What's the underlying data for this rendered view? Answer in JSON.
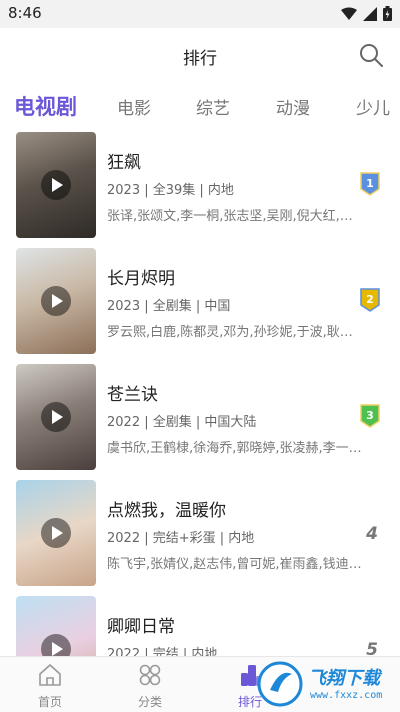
{
  "status_bar": {
    "time": "8:46"
  },
  "header": {
    "title": "排行"
  },
  "tabs": [
    {
      "label": "电视剧",
      "active": true
    },
    {
      "label": "电影",
      "active": false
    },
    {
      "label": "综艺",
      "active": false
    },
    {
      "label": "动漫",
      "active": false
    },
    {
      "label": "少儿",
      "active": false
    }
  ],
  "items": [
    {
      "title": "狂飙",
      "meta": "2023 | 全39集 | 内地",
      "cast": "张译,张颂文,李一桐,张志坚,吴刚,倪大红,韩…",
      "rank": "1"
    },
    {
      "title": "长月烬明",
      "meta": "2023 | 全剧集 | 中国",
      "cast": "罗云熙,白鹿,陈都灵,邓为,孙珍妮,于波,耿業…",
      "rank": "2"
    },
    {
      "title": "苍兰诀",
      "meta": "2022 | 全剧集 | 中国大陆",
      "cast": "虞书欣,王鹤棣,徐海乔,郭晓婷,张凌赫,李一…",
      "rank": "3"
    },
    {
      "title": "点燃我，温暖你",
      "meta": "2022 | 完结+彩蛋 | 内地",
      "cast": "陈飞宇,张婧仪,赵志伟,曾可妮,崔雨鑫,钱迪…",
      "rank": "4"
    },
    {
      "title": "卿卿日常",
      "meta": "2022 | 完结 | 内地",
      "cast": "",
      "rank": "5"
    }
  ],
  "bottom_nav": [
    {
      "label": "首页",
      "active": false
    },
    {
      "label": "分类",
      "active": false
    },
    {
      "label": "排行",
      "active": true
    }
  ],
  "watermark": {
    "text": "飞翔下载",
    "url": "www.fxxz.com"
  },
  "colors": {
    "accent": "#6b58d6",
    "badge_1": "#5b8fe0",
    "badge_2": "#e6b800",
    "badge_3": "#4fbf4f"
  }
}
